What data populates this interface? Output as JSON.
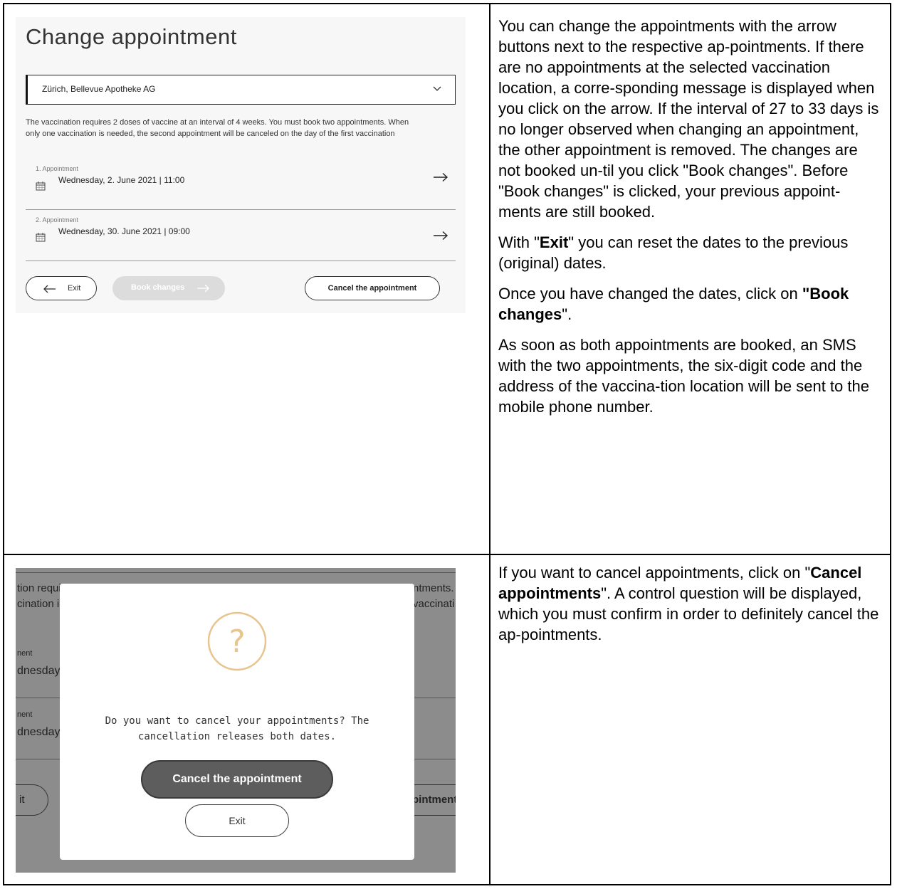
{
  "section1": {
    "screenshot": {
      "title": "Change appointment",
      "location": "Zürich, Bellevue Apotheke AG",
      "info_line1": "The vaccination requires 2 doses of vaccine at an interval of 4 weeks. You must book two appointments. When",
      "info_line2": "only one vaccination is needed, the second appointment will be canceled on the day of the first vaccination",
      "appointments": [
        {
          "label": "1. Appointment",
          "date": "Wednesday, 2. June 2021 | 11:00"
        },
        {
          "label": "2. Appointment",
          "date": "Wednesday, 30. June 2021 | 09:00"
        }
      ],
      "exit_label": "Exit",
      "book_changes_label": "Book changes",
      "cancel_label": "Cancel the appointment"
    },
    "description": {
      "p1": "You can change the appointments with the arrow buttons next to the respective ap-pointments. If there are no appointments at the selected vaccination location, a corre-sponding message is displayed when you click on the arrow. If the interval of 27 to 33 days is no longer observed when changing an appointment, the other appointment is removed. The changes are not booked un-til you click \"Book changes\". Before \"Book changes\" is clicked, your previous appoint-ments are still booked.",
      "p2_before": "With \"",
      "p2_bold": "Exit",
      "p2_after": "\" you can reset the dates to the previous (original) dates.",
      "p3_before": "Once you have changed the dates, click on ",
      "p3_bold": "\"Book changes",
      "p3_after": "\".",
      "p4": "As soon as both appointments are booked, an SMS with the two appointments, the six-digit code and the address of the vaccina-tion location will be sent to the mobile phone number."
    }
  },
  "section2": {
    "screenshot": {
      "bg_fragments": {
        "left_line1": "tion requi",
        "left_line2": "cination i",
        "right_line1": "ntments.",
        "right_line2": "vaccinati",
        "appt1_label": "nent",
        "appt1_date": "dnesday,",
        "appt2_label": "nent",
        "appt2_date": "dnesday,",
        "left_button": "it",
        "right_button": "pintment"
      },
      "dialog": {
        "icon": "question-circle-icon",
        "message_line1": "Do you want to cancel your appointments? The",
        "message_line2": "cancellation releases both dates.",
        "confirm_label": "Cancel the appointment",
        "exit_label": "Exit"
      }
    },
    "description": {
      "p1_before": "If you want to cancel appointments, click on \"",
      "p1_bold": "Cancel appointments",
      "p1_after": "\". A control question will be displayed, which you must confirm in order to definitely cancel the ap-pointments."
    }
  },
  "colors": {
    "dialog_icon": "#e8c48e",
    "overlay_bg": "#8c8c8c",
    "confirm_button": "#5d5d5d",
    "disabled_button": "#dcdcdc"
  }
}
